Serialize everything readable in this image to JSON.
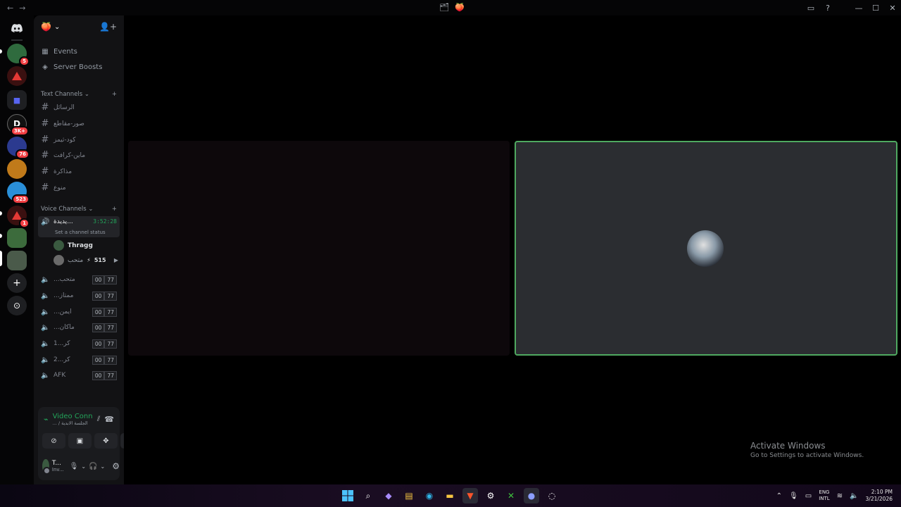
{
  "titlebar": {
    "nav_back": "←",
    "nav_forward": "→",
    "center_icon_a": "🗂",
    "center_icon_b": "🍑",
    "inbox_icon": "▭",
    "help_icon": "?",
    "minimize": "—",
    "maximize": "☐",
    "close": "✕"
  },
  "rail": {
    "home_icon": "discord-logo-icon",
    "badges": [
      "5",
      "3K+",
      "76",
      "523",
      "1"
    ],
    "add_server_label": "+",
    "explore_label": "⊙"
  },
  "server": {
    "name": "🍑",
    "chevron": "⌄",
    "invite_icon": "👤+"
  },
  "menu": {
    "events": "Events",
    "boosts": "Server Boosts"
  },
  "text_category": {
    "label": "Text Channels",
    "chevron": "⌄",
    "add": "+"
  },
  "text_channels": [
    "الرسائل",
    "صور-مقاطع",
    "كود-ثيمز",
    "ماين-كرافت",
    "مذاكرة",
    "منوع"
  ],
  "voice_category": {
    "label": "Voice Channels",
    "chevron": "⌄",
    "add": "+"
  },
  "active_voice": {
    "name": "يديدة...",
    "timer": "3:52:28",
    "status": "Set a channel status",
    "users": [
      {
        "name": "Thragg",
        "badge": ""
      },
      {
        "name": "متحب",
        "badge": "515"
      }
    ]
  },
  "voice_channels": [
    {
      "name": "...متحب",
      "count_a": "00",
      "count_b": "77"
    },
    {
      "name": "...ممتاز",
      "count_a": "00",
      "count_b": "77"
    },
    {
      "name": "...ايمن",
      "count_a": "00",
      "count_b": "77"
    },
    {
      "name": "...ماكان",
      "count_a": "00",
      "count_b": "77"
    },
    {
      "name": "1...كر",
      "count_a": "00",
      "count_b": "77"
    },
    {
      "name": "2...كر",
      "count_a": "00",
      "count_b": "77"
    },
    {
      "name": "AFK",
      "count_a": "00",
      "count_b": "77"
    }
  ],
  "voice_panel": {
    "status": "Video Connected",
    "subtitle": "... / الجلسة الابدية",
    "username": "T...",
    "user_status": "Inv..."
  },
  "watermark": {
    "title": "Activate Windows",
    "subtitle": "Go to Settings to activate Windows."
  },
  "taskbar": {
    "lang_top": "ENG",
    "lang_bottom": "INTL",
    "time": "2:10 PM",
    "date": "3/21/2026"
  },
  "colors": {
    "accent_green": "#23a55a",
    "tile_border": "#4fa960",
    "badge_red": "#f23f43"
  }
}
